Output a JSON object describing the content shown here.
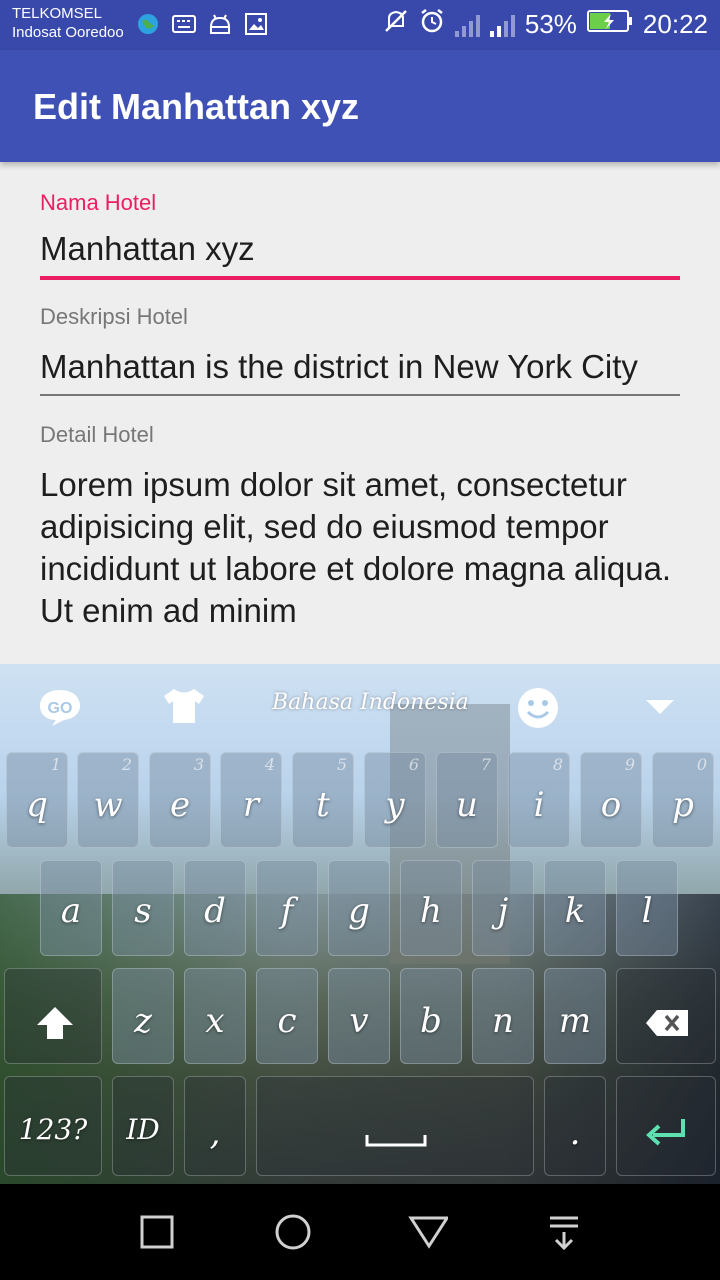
{
  "status_bar": {
    "carrier1": "TELKOMSEL",
    "carrier2": "Indosat Ooredoo",
    "battery": "53%",
    "time": "20:22"
  },
  "app_bar": {
    "title": "Edit Manhattan xyz"
  },
  "form": {
    "nama_label": "Nama Hotel",
    "nama_value": "Manhattan xyz",
    "deskripsi_label": "Deskripsi Hotel",
    "deskripsi_value": "Manhattan is the district in New York City",
    "detail_label": "Detail Hotel",
    "detail_value": "Lorem ipsum dolor sit amet, consectetur adipisicing elit, sed do eiusmod tempor incididunt ut labore et dolore magna aliqua. Ut enim ad minim"
  },
  "keyboard": {
    "language": "Bahasa Indonesia",
    "logo": "GO",
    "row1": [
      "q",
      "w",
      "e",
      "r",
      "t",
      "y",
      "u",
      "i",
      "o",
      "p"
    ],
    "row1_hints": [
      "1",
      "2",
      "3",
      "4",
      "5",
      "6",
      "7",
      "8",
      "9",
      "0"
    ],
    "row2": [
      "a",
      "s",
      "d",
      "f",
      "g",
      "h",
      "j",
      "k",
      "l"
    ],
    "row3": [
      "z",
      "x",
      "c",
      "v",
      "b",
      "n",
      "m"
    ],
    "num_key": "123?",
    "lang_key": "ID",
    "comma": ",",
    "period": "."
  },
  "colors": {
    "primary": "#3f51b5",
    "accent": "#e91e63",
    "status": "#3949ab"
  }
}
